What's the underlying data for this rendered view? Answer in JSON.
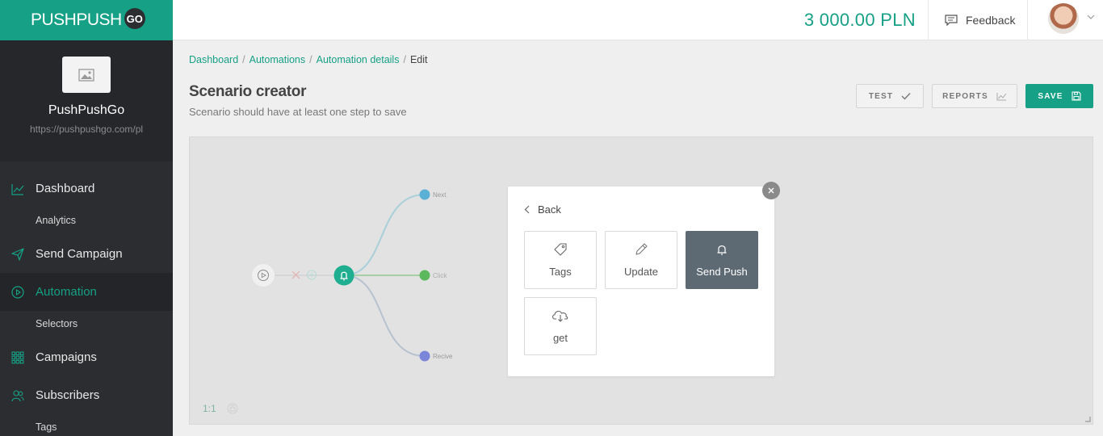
{
  "brand": {
    "name": "PUSHPUSH",
    "badge": "GO"
  },
  "site": {
    "name": "PushPushGo",
    "url": "https://pushpushgo.com/pl"
  },
  "sidebar": {
    "items": [
      {
        "label": "Dashboard",
        "icon": "chart-line-icon"
      },
      {
        "label": "Analytics"
      },
      {
        "label": "Send Campaign",
        "icon": "paper-plane-icon"
      },
      {
        "label": "Automation",
        "icon": "play-circle-icon"
      },
      {
        "label": "Selectors"
      },
      {
        "label": "Campaigns",
        "icon": "grid-icon"
      },
      {
        "label": "Subscribers",
        "icon": "users-icon"
      },
      {
        "label": "Tags"
      }
    ]
  },
  "header": {
    "balance": "3  000.00 PLN",
    "feedback_label": "Feedback"
  },
  "breadcrumb": [
    "Dashboard",
    "Automations",
    "Automation details",
    "Edit"
  ],
  "page": {
    "title": "Scenario creator",
    "subtitle": "Scenario should have at least one step to save"
  },
  "actions": {
    "test": "TEST",
    "reports": "REPORTS",
    "save": "SAVE"
  },
  "canvas": {
    "zoom_label": "1:1",
    "branches": [
      {
        "label": "Next",
        "color": "#5bb0d6"
      },
      {
        "label": "Click",
        "color": "#5cb85c"
      },
      {
        "label": "Recive",
        "color": "#7b86d8"
      }
    ]
  },
  "modal": {
    "back_label": "Back",
    "options": [
      {
        "label": "Tags",
        "icon": "tag-icon",
        "selected": false
      },
      {
        "label": "Update",
        "icon": "pencil-icon",
        "selected": false
      },
      {
        "label": "Send Push",
        "icon": "bell-icon",
        "selected": true
      },
      {
        "label": "get",
        "icon": "cloud-download-icon",
        "selected": false
      }
    ]
  },
  "colors": {
    "accent": "#16a085",
    "sidebar": "#2b2d30",
    "selected_card": "#5d6a74"
  }
}
